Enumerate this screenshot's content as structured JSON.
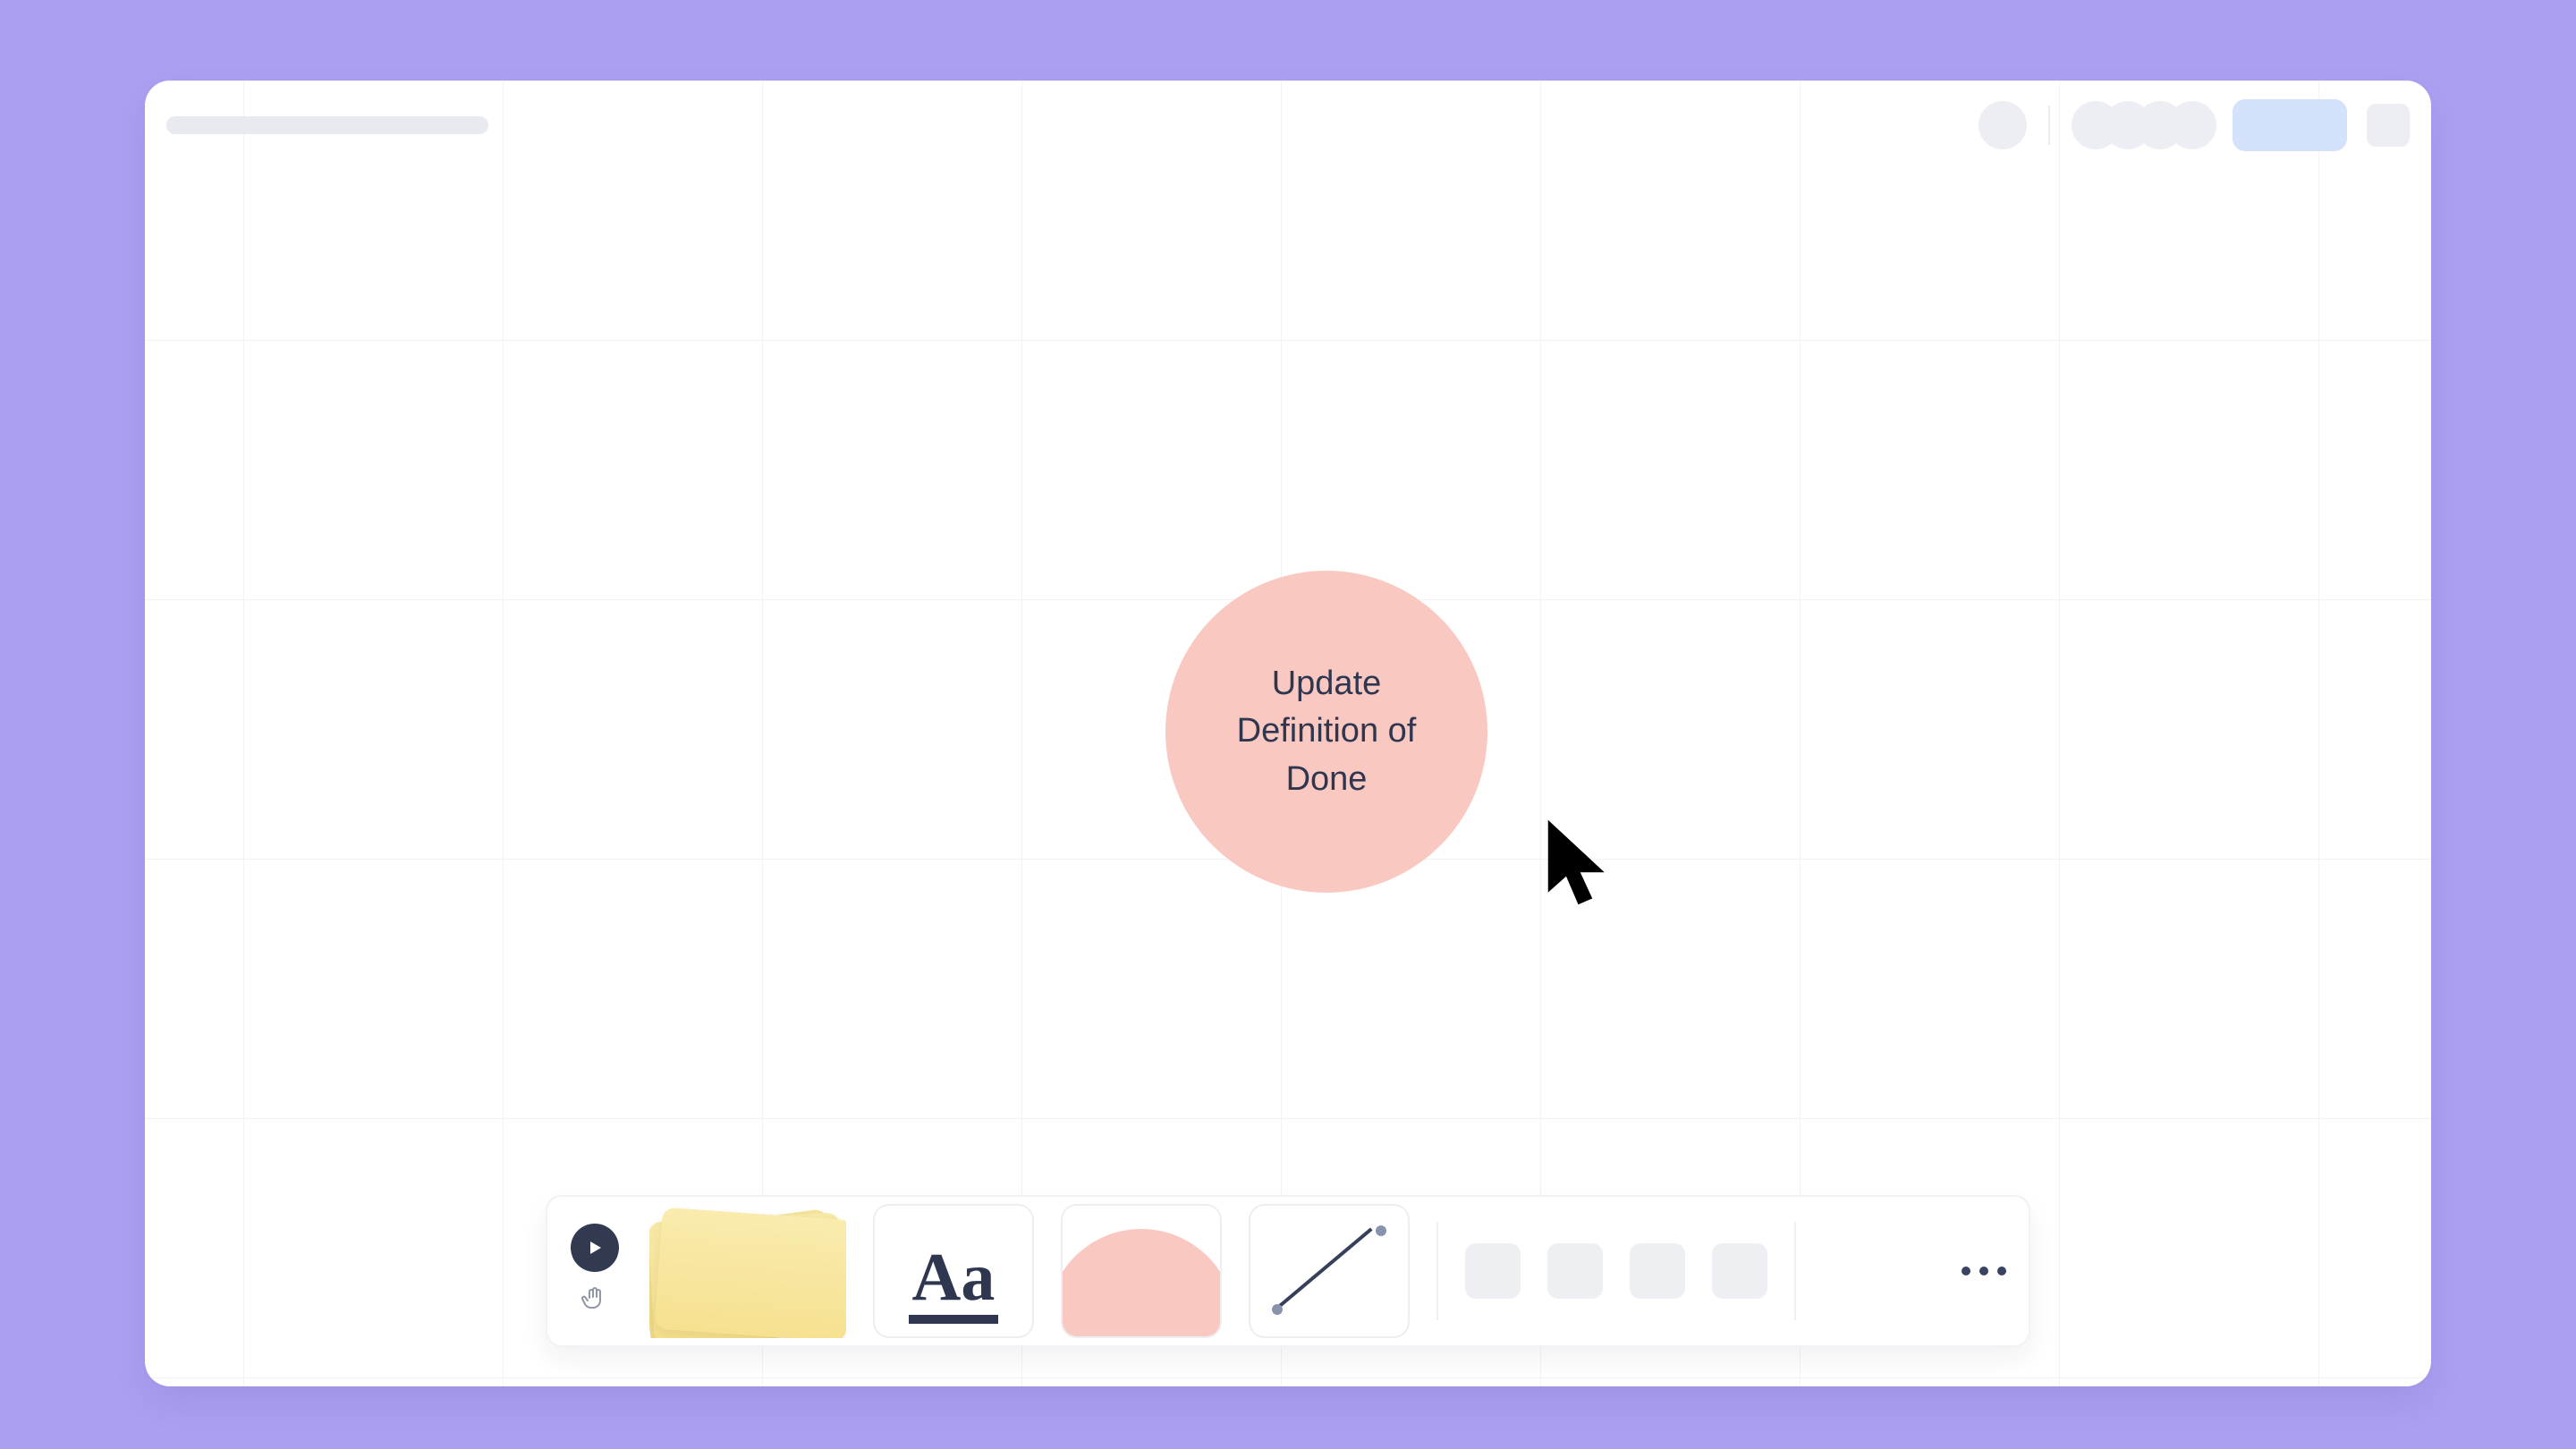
{
  "canvas": {
    "node_text": "Update Definition of Done"
  },
  "toolbar": {
    "text_tool_label": "Aa"
  }
}
